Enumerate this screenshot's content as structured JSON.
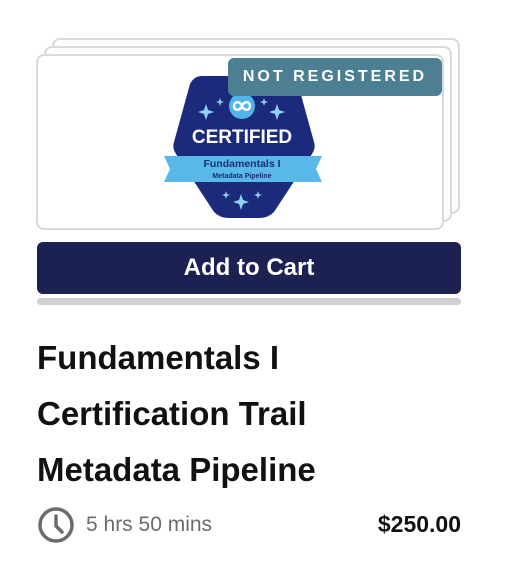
{
  "status_tag": "NOT REGISTERED",
  "badge": {
    "heading": "CERTIFIED",
    "banner_line1": "Fundamentals I",
    "banner_line2": "Metadata Pipeline",
    "icon": "infinity-logo-icon",
    "colors": {
      "hexagon": "#1b2a7a",
      "banner": "#59b8e8",
      "logo": "#4fb6e8"
    }
  },
  "add_to_cart_label": "Add to Cart",
  "title": {
    "line1": "Fundamentals I",
    "line2": "Certification Trail",
    "line3": "Metadata Pipeline"
  },
  "duration": "5 hrs 50 mins",
  "duration_icon": "clock-icon",
  "price": "$250.00",
  "colors": {
    "button": "#1d2151",
    "status_tag": "#4b7f91",
    "card_border": "#d5dadd"
  }
}
